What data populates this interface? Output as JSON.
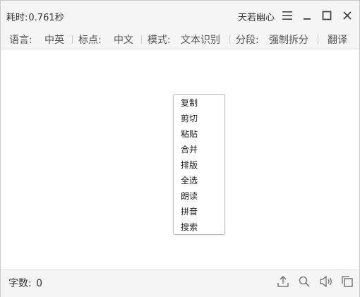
{
  "titlebar": {
    "time_label": "耗时:",
    "time_value": "0.761秒",
    "user_name": "天若幽心",
    "icons": [
      "menu-icon",
      "minimize-icon",
      "maximize-icon",
      "close-icon"
    ]
  },
  "options": {
    "language_label": "语言:",
    "language_value": "中英",
    "punctuation_label": "标点:",
    "punctuation_value": "中文",
    "mode_label": "模式:",
    "mode_value": "文本识别",
    "segment_label": "分段:",
    "segment_value": "强制拆分",
    "translate_label": "翻译"
  },
  "context_menu": {
    "items": [
      {
        "label": "复制"
      },
      {
        "label": "剪切"
      },
      {
        "label": "粘贴"
      },
      {
        "label": "合并"
      },
      {
        "label": "排版"
      },
      {
        "label": "全选"
      },
      {
        "label": "朗读"
      },
      {
        "label": "拼音"
      },
      {
        "label": "搜索"
      }
    ]
  },
  "statusbar": {
    "word_count_label": "字数:",
    "word_count_value": "0",
    "icons": [
      "upload-icon",
      "search-icon",
      "speaker-icon",
      "copy-icon"
    ]
  },
  "colors": {
    "bar_background": "#f5f5f5",
    "text": "#333333",
    "icon": "#555555",
    "border": "#c9c9c9"
  }
}
